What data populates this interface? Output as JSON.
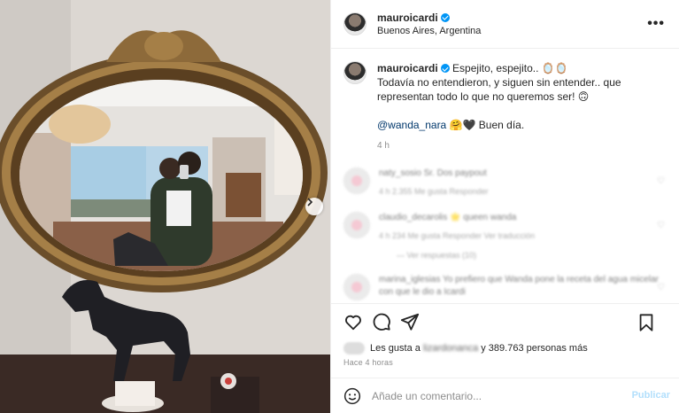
{
  "post": {
    "username": "mauroicardi",
    "location": "Buenos Aires, Argentina",
    "more_label": "•••"
  },
  "caption": {
    "username": "mauroicardi",
    "line1": "Espejito, espejito.. 🪞🪞",
    "line2": "Todavía no entendieron, y siguen sin entender.. que representan todo lo que no queremos ser! 🙃",
    "mention": "@wanda_nara",
    "mention_tail": "🤗🖤 Buen día.",
    "time": "4 h"
  },
  "comments": [
    {
      "user": "naty_sosio",
      "text": "Sr. Dos paypout",
      "meta": "4 h   2.355 Me gusta   Responder"
    },
    {
      "user": "claudio_decarolis",
      "text": "🌟 queen wanda",
      "meta": "4 h   234 Me gusta   Responder   Ver traducción",
      "replies": "— Ver respuestas (10)"
    },
    {
      "user": "marina_iglesias",
      "text": "Yo prefiero que Wanda pone la receta del agua micelar con que le dio a Icardi",
      "meta": ""
    }
  ],
  "likes": {
    "prefix": "Les gusta a",
    "blurred_name": "lizardonanca",
    "suffix": "y 389.763 personas más"
  },
  "post_time": "Hace 4 horas",
  "add_comment": {
    "placeholder": "Añade un comentario...",
    "publish_label": "Publicar"
  },
  "colors": {
    "accent": "#0095f6",
    "publish_disabled": "#b2dffc",
    "mention": "#00376b"
  }
}
